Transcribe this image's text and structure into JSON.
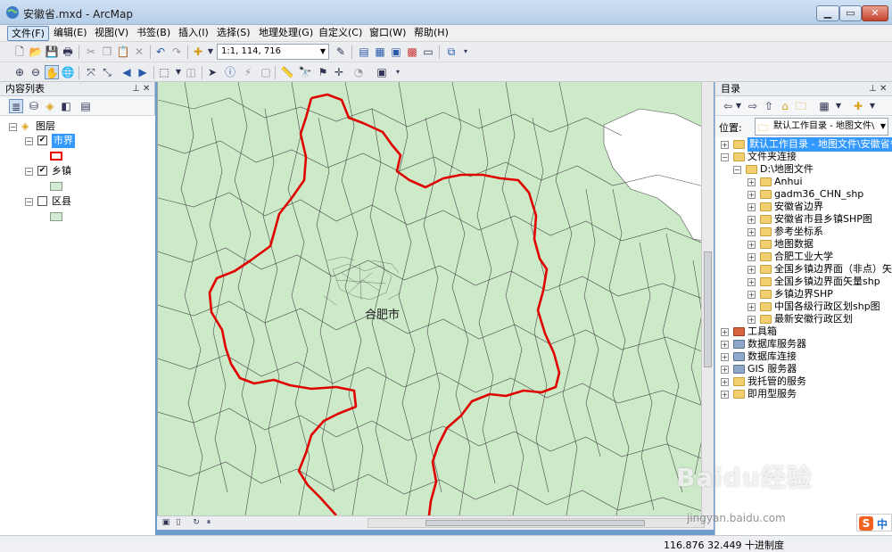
{
  "window": {
    "title": "安徽省.mxd - ArcMap"
  },
  "menu": [
    "文件(F)",
    "编辑(E)",
    "视图(V)",
    "书签(B)",
    "插入(I)",
    "选择(S)",
    "地理处理(G)",
    "自定义(C)",
    "窗口(W)",
    "帮助(H)"
  ],
  "toolbar": {
    "scale": "1:1, 114, 716"
  },
  "toc": {
    "title": "内容列表",
    "root": "图层",
    "layers": [
      {
        "label": "市界",
        "checked": true,
        "selected": true,
        "symbol": "red-outline"
      },
      {
        "label": "乡镇",
        "checked": true,
        "selected": false,
        "symbol": "green-fill"
      },
      {
        "label": "区县",
        "checked": false,
        "selected": false,
        "symbol": "green-fill"
      }
    ]
  },
  "map": {
    "label": "合肥市",
    "boundary_color": "#e00000",
    "fill_color": "#cce9c8"
  },
  "catalog": {
    "title": "目录",
    "location_label": "位置:",
    "location_value": "默认工作目录 - 地图文件\\",
    "items": {
      "home": "默认工作目录 - 地图文件\\安徽省省",
      "folder_connections": "文件夹连接",
      "drive": "D:\\地图文件",
      "folders": [
        "Anhui",
        "gadm36_CHN_shp",
        "安徽省边界",
        "安徽省市县乡镇SHP图",
        "参考坐标系",
        "地图数据",
        "合肥工业大学",
        "全国乡镇边界面（非点）矢",
        "全国乡镇边界面矢量shp",
        "乡镇边界SHP",
        "中国各级行政区划shp图",
        "最新安徽行政区划"
      ],
      "toolbox": "工具箱",
      "db_servers": "数据库服务器",
      "db_connections": "数据库连接",
      "gis_servers": "GIS 服务器",
      "hosted_services": "我托管的服务",
      "ready_services": "即用型服务"
    }
  },
  "status": {
    "coords": "116.876  32.449 十进制度"
  },
  "watermark": {
    "text": "Baidu经验",
    "url": "jingyan.baidu.com"
  },
  "ime": {
    "label": "中"
  }
}
